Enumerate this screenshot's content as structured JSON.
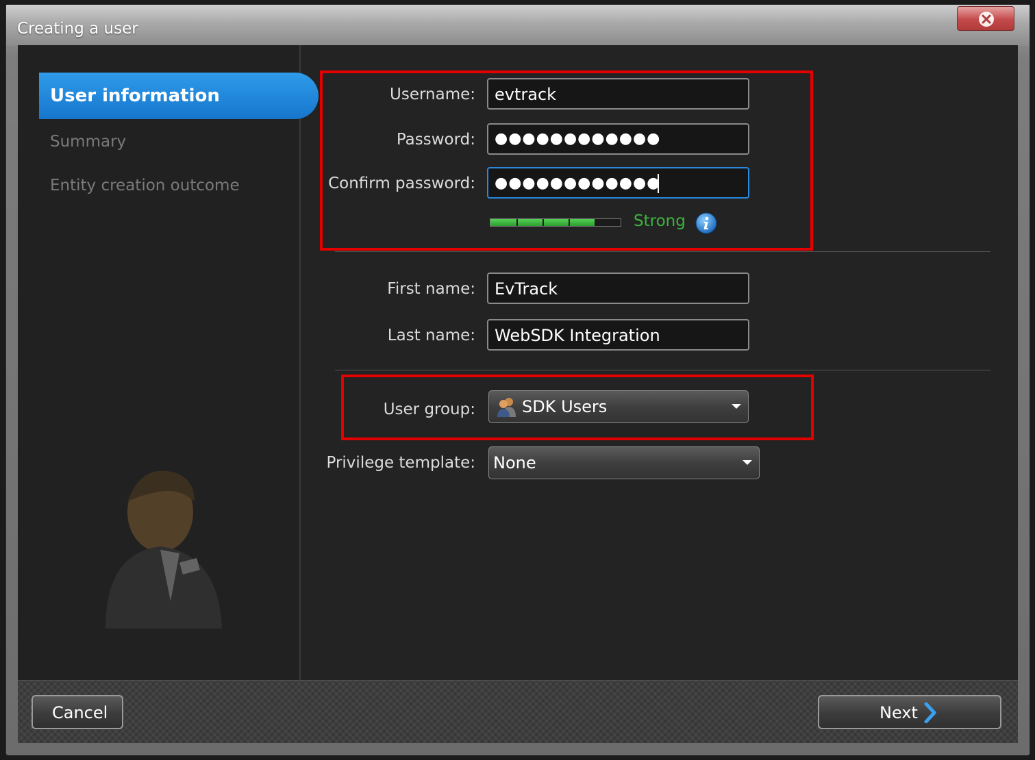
{
  "window": {
    "title": "Creating a user"
  },
  "steps": [
    {
      "label": "User information",
      "active": true
    },
    {
      "label": "Summary",
      "active": false
    },
    {
      "label": "Entity creation outcome",
      "active": false
    }
  ],
  "form": {
    "username": {
      "label": "Username:",
      "value": "evtrack"
    },
    "password": {
      "label": "Password:",
      "value": "●●●●●●●●●●●●"
    },
    "confirm_password": {
      "label": "Confirm password:",
      "value": "●●●●●●●●●●●●"
    },
    "strength": {
      "text": "Strong",
      "level": 0.8,
      "color": "#3cb43c"
    },
    "first_name": {
      "label": "First name:",
      "value": "EvTrack"
    },
    "last_name": {
      "label": "Last name:",
      "value": "WebSDK Integration"
    },
    "user_group": {
      "label": "User group:",
      "value": "SDK Users",
      "icon": "user-group-icon"
    },
    "privilege_template": {
      "label": "Privilege template:",
      "value": "None"
    }
  },
  "footer": {
    "cancel_label": "Cancel",
    "next_label": "Next"
  },
  "colors": {
    "accent": "#1e86dc",
    "highlight_box": "#e50000",
    "close": "#c44a4a"
  }
}
